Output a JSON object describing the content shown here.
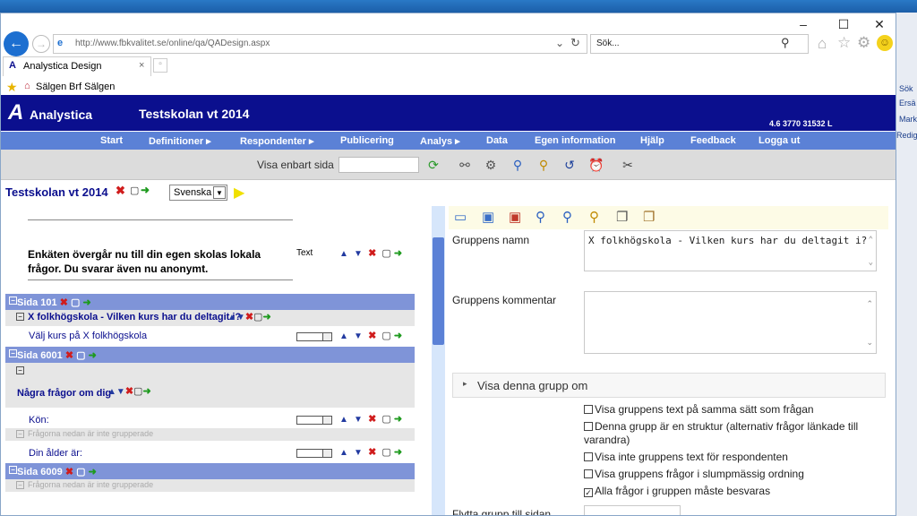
{
  "browser": {
    "url": "http://www.fbkvalitet.se/online/qa/QADesign.aspx",
    "search_placeholder": "Sök...",
    "tab_title": "Analystica Design",
    "favorites": [
      "Sälgen",
      "Brf Sälgen"
    ]
  },
  "desktop_right": [
    "Sök",
    "Ersä",
    "Mark",
    "Redige"
  ],
  "site": {
    "logo": "Analystica",
    "title": "Testskolan vt 2014",
    "version": "4.6 3770 31532 L",
    "menu": [
      "Start",
      "Definitioner",
      "Respondenter",
      "Publicering",
      "Analys",
      "Data",
      "Egen information",
      "Hjälp",
      "Feedback",
      "Logga ut"
    ],
    "toolbar_label": "Visa enbart sida"
  },
  "left": {
    "title": "Testskolan vt 2014",
    "language": "Svenska",
    "intro": "Enkäten övergår nu till din egen skolas lokala frågor. Du svarar även nu anonymt.",
    "intro_type": "Text",
    "sida1": "Sida 101",
    "group1": "X folkhögskola - Vilken kurs har du deltagit i?",
    "q1": "Välj kurs på X folkhögskola",
    "sida2": "Sida 6001",
    "group2": "Några frågor om dig",
    "q2": "Kön:",
    "ungrouped": "Frågorna nedan är inte grupperade",
    "q3": "Din ålder är:",
    "sida3": "Sida 6009",
    "ungrouped2": "Frågorna nedan är inte grupperade"
  },
  "right": {
    "group_name_label": "Gruppens namn",
    "group_name_value": "X folkhögskola - Vilken kurs har du deltagit i?",
    "group_comment_label": "Gruppens kommentar",
    "show_if": "Visa denna grupp om",
    "options": [
      {
        "label": "Visa gruppens text på samma sätt som frågan",
        "checked": false
      },
      {
        "label": "Denna grupp är en struktur (alternativ frågor länkade till varandra)",
        "checked": false
      },
      {
        "label": "Visa inte gruppens text för respondenten",
        "checked": false
      },
      {
        "label": "Visa gruppens frågor i slumpmässig ordning",
        "checked": false
      },
      {
        "label": "Alla frågor i gruppen måste besvaras",
        "checked": true
      }
    ],
    "move_label": "Flytta grupp till sidan"
  },
  "colors": {
    "header": "#0b0f8e",
    "menu": "#5b81d6",
    "sida_bar": "#7f94d8"
  }
}
